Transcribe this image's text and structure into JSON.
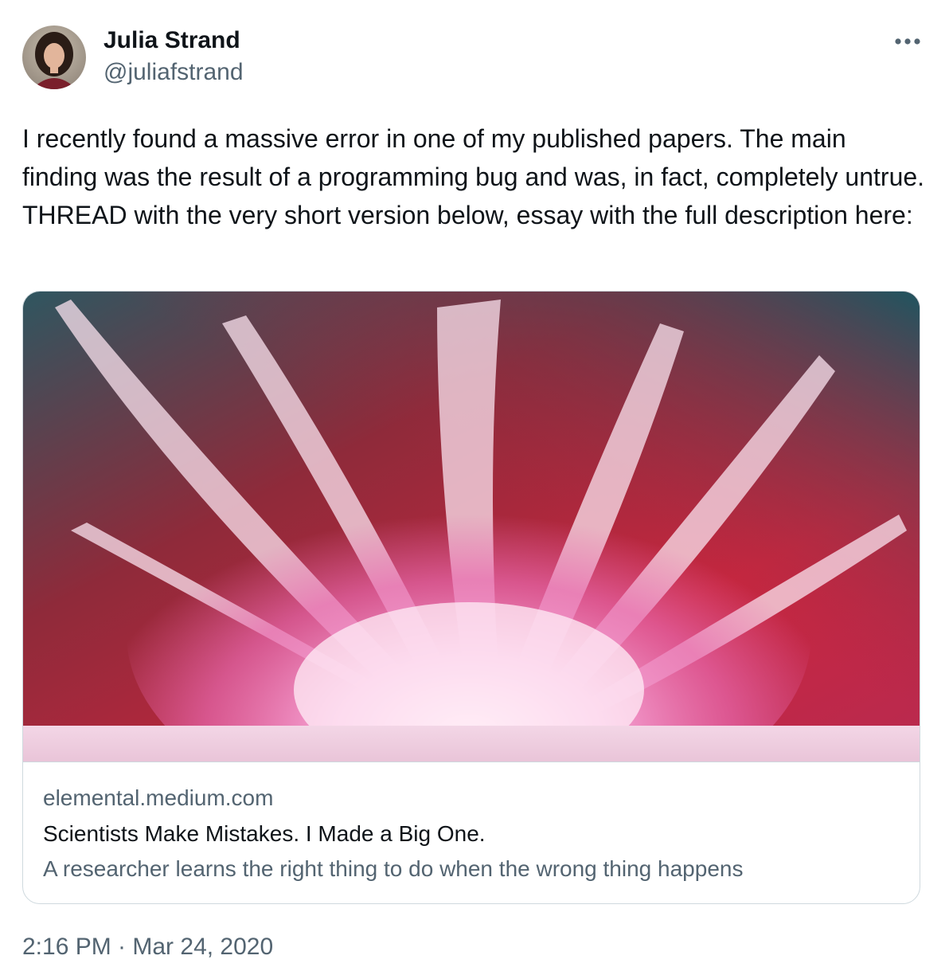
{
  "author": {
    "name": "Julia Strand",
    "handle": "@juliafstrand",
    "avatar_icon": "profile-photo"
  },
  "menu": {
    "icon": "more-horizontal-icon"
  },
  "tweet": {
    "text": "I recently found a massive error in one of my published papers. The main finding was the result of a programming bug and was, in fact, completely untrue. THREAD with the very short version below, essay with the full description here:"
  },
  "card": {
    "image_icon": "pink-powder-explosion-image",
    "domain": "elemental.medium.com",
    "title": "Scientists Make Mistakes. I Made a Big One.",
    "description": "A researcher learns the right thing to do when the wrong thing happens"
  },
  "meta": {
    "timestamp": "2:16 PM · Mar 24, 2020"
  },
  "colors": {
    "text_primary": "#0f1419",
    "text_secondary": "#536471",
    "border": "#cfd9de"
  }
}
